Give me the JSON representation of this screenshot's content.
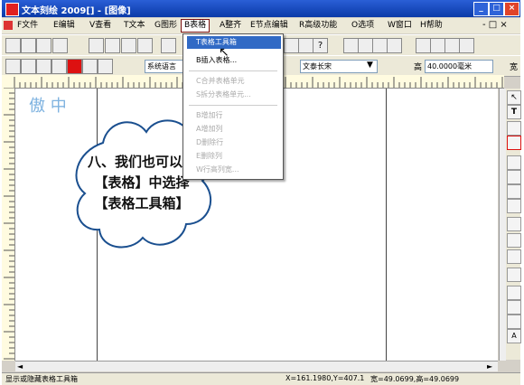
{
  "window": {
    "title": "文本刻绘 2009[] - [图像]"
  },
  "menus": [
    "F文件",
    "E编辑",
    "V查看",
    "T文本",
    "G图形",
    "B表格",
    "A整齐",
    "E节点编辑",
    "R高级功能",
    "O选项",
    "W窗口",
    "H帮助"
  ],
  "menu_right": "- □ ×",
  "dropdown": {
    "items": [
      {
        "label": "T表格工具箱",
        "state": "highlight"
      },
      {
        "label": "B插入表格...",
        "state": "normal"
      },
      {
        "label": "C合并表格单元",
        "state": "disabled"
      },
      {
        "label": "S拆分表格单元...",
        "state": "disabled"
      },
      {
        "label": "B增加行",
        "state": "disabled"
      },
      {
        "label": "A增加列",
        "state": "disabled"
      },
      {
        "label": "D删除行",
        "state": "disabled"
      },
      {
        "label": "E删除列",
        "state": "disabled"
      },
      {
        "label": "W行高列宽...",
        "state": "disabled"
      }
    ]
  },
  "toolbar2": {
    "font_lang": "系统语言",
    "font_name": "文泰长宋",
    "height_label": "高",
    "height_value": "40.0000毫米",
    "width_label": "宽"
  },
  "watermark": "傲  中",
  "callout": "八、我们也可以在【表格】中选择【表格工具箱】",
  "status": {
    "message": "显示或隐藏表格工具箱",
    "coords": "X=161.1980,Y=407.1",
    "size": "宽=49.0699,高=49.0699"
  },
  "colors": {
    "titlebar": "#0a3aa8",
    "highlight": "#316ac5",
    "ruler": "#fffbe0"
  }
}
